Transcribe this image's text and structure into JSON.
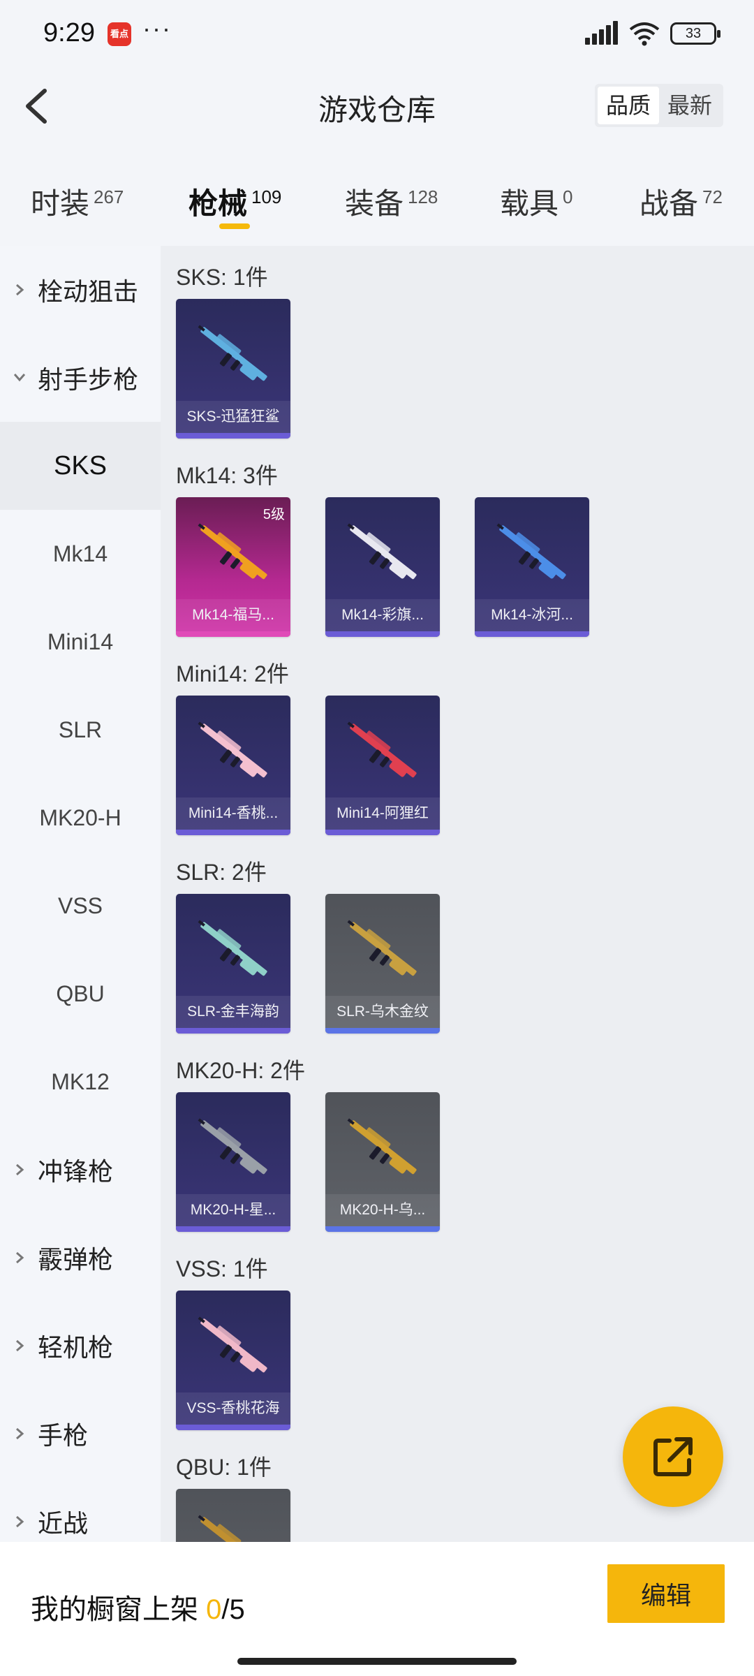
{
  "status_bar": {
    "time": "9:29",
    "app_badge": "看点",
    "battery": "33"
  },
  "header": {
    "title": "游戏仓库",
    "sort_options": [
      "品质",
      "最新"
    ]
  },
  "tabs": [
    {
      "label": "时装",
      "count": "267"
    },
    {
      "label": "枪械",
      "count": "109"
    },
    {
      "label": "装备",
      "count": "128"
    },
    {
      "label": "载具",
      "count": "0"
    },
    {
      "label": "战备",
      "count": "72"
    }
  ],
  "sidebar": {
    "items": [
      {
        "label": "栓动狙击",
        "type": "group"
      },
      {
        "label": "射手步枪",
        "type": "group"
      },
      {
        "label": "SKS",
        "type": "sub"
      },
      {
        "label": "Mk14",
        "type": "sub"
      },
      {
        "label": "Mini14",
        "type": "sub"
      },
      {
        "label": "SLR",
        "type": "sub"
      },
      {
        "label": "MK20-H",
        "type": "sub"
      },
      {
        "label": "VSS",
        "type": "sub"
      },
      {
        "label": "QBU",
        "type": "sub"
      },
      {
        "label": "MK12",
        "type": "sub"
      },
      {
        "label": "冲锋枪",
        "type": "group"
      },
      {
        "label": "霰弹枪",
        "type": "group"
      },
      {
        "label": "轻机枪",
        "type": "group"
      },
      {
        "label": "手枪",
        "type": "group"
      },
      {
        "label": "近战",
        "type": "group"
      }
    ]
  },
  "sections": [
    {
      "title": "SKS: 1件",
      "items": [
        {
          "name": "SKS-迅猛狂鲨",
          "tier": "purple",
          "gun": "#5fb0e0"
        }
      ]
    },
    {
      "title": "Mk14: 3件",
      "items": [
        {
          "name": "Mk14-福马...",
          "tier": "gold",
          "level": "5级",
          "gun": "#f0a020"
        },
        {
          "name": "Mk14-彩旗...",
          "tier": "purple",
          "gun": "#e8e8f0"
        },
        {
          "name": "Mk14-冰河...",
          "tier": "purple",
          "gun": "#4c8ee8"
        }
      ]
    },
    {
      "title": "Mini14: 2件",
      "items": [
        {
          "name": "Mini14-香桃...",
          "tier": "purple",
          "gun": "#f4c0d0"
        },
        {
          "name": "Mini14-阿狸红",
          "tier": "purple",
          "gun": "#e04050"
        }
      ]
    },
    {
      "title": "SLR: 2件",
      "items": [
        {
          "name": "SLR-金丰海韵",
          "tier": "purple",
          "gun": "#8fd0c8"
        },
        {
          "name": "SLR-乌木金纹",
          "tier": "grey",
          "gun": "#c8a040"
        }
      ]
    },
    {
      "title": "MK20-H: 2件",
      "items": [
        {
          "name": "MK20-H-星...",
          "tier": "purple",
          "gun": "#9aa0a8"
        },
        {
          "name": "MK20-H-乌...",
          "tier": "grey",
          "gun": "#d0a030"
        }
      ]
    },
    {
      "title": "VSS: 1件",
      "items": [
        {
          "name": "VSS-香桃花海",
          "tier": "purple",
          "gun": "#f0b8c8"
        }
      ]
    },
    {
      "title": "QBU: 1件",
      "items": [
        {
          "name": "",
          "tier": "grey",
          "gun": "#c09030"
        }
      ]
    }
  ],
  "bottom": {
    "shelf_label": "我的橱窗上架 ",
    "shelf_count": "0",
    "shelf_total": "/5",
    "edit_label": "编辑"
  },
  "colors": {
    "accent": "#f5b60c",
    "purple_card": "#3b3578",
    "gold_card": "#d032a8",
    "grey_card": "#5f6268"
  }
}
